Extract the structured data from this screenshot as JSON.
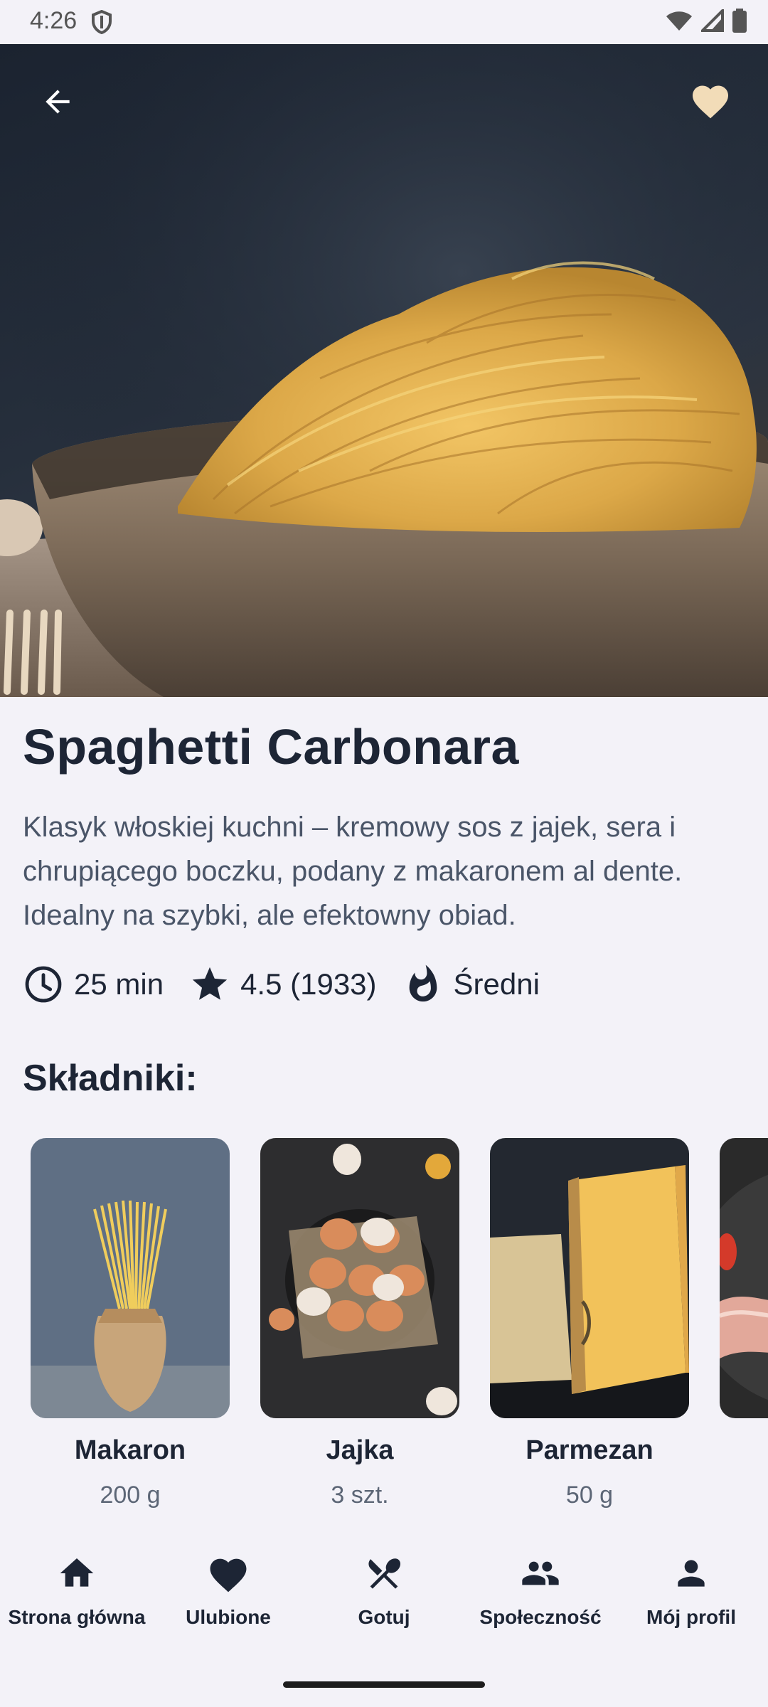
{
  "status_bar": {
    "time": "4:26",
    "icons": [
      "shield-icon",
      "wifi-icon",
      "signal-icon",
      "battery-icon"
    ]
  },
  "header": {
    "back_icon": "arrow-left-icon",
    "favorite_icon": "heart-icon",
    "favorite_color": "#f2dcb8"
  },
  "recipe": {
    "title": "Spaghetti Carbonara",
    "description": "Klasyk włoskiej kuchni – kremowy sos z jajek, sera i chrupiącego boczku, podany z makaronem al dente. Idealny na szybki, ale efektowny obiad.",
    "time": "25 min",
    "rating": "4.5 (1933)",
    "difficulty": "Średni"
  },
  "ingredients_section": {
    "title": "Składniki:",
    "items": [
      {
        "name": "Makaron",
        "quantity": "200 g"
      },
      {
        "name": "Jajka",
        "quantity": "3 szt."
      },
      {
        "name": "Parmezan",
        "quantity": "50 g"
      }
    ]
  },
  "bottom_nav": {
    "items": [
      {
        "label": "Strona główna",
        "icon": "home-icon"
      },
      {
        "label": "Ulubione",
        "icon": "heart-icon"
      },
      {
        "label": "Gotuj",
        "icon": "utensils-icon"
      },
      {
        "label": "Społeczność",
        "icon": "people-icon"
      },
      {
        "label": "Mój profil",
        "icon": "person-icon"
      }
    ]
  },
  "colors": {
    "background": "#f3f2f8",
    "text_primary": "#1d2535",
    "text_secondary": "#4a5568"
  }
}
